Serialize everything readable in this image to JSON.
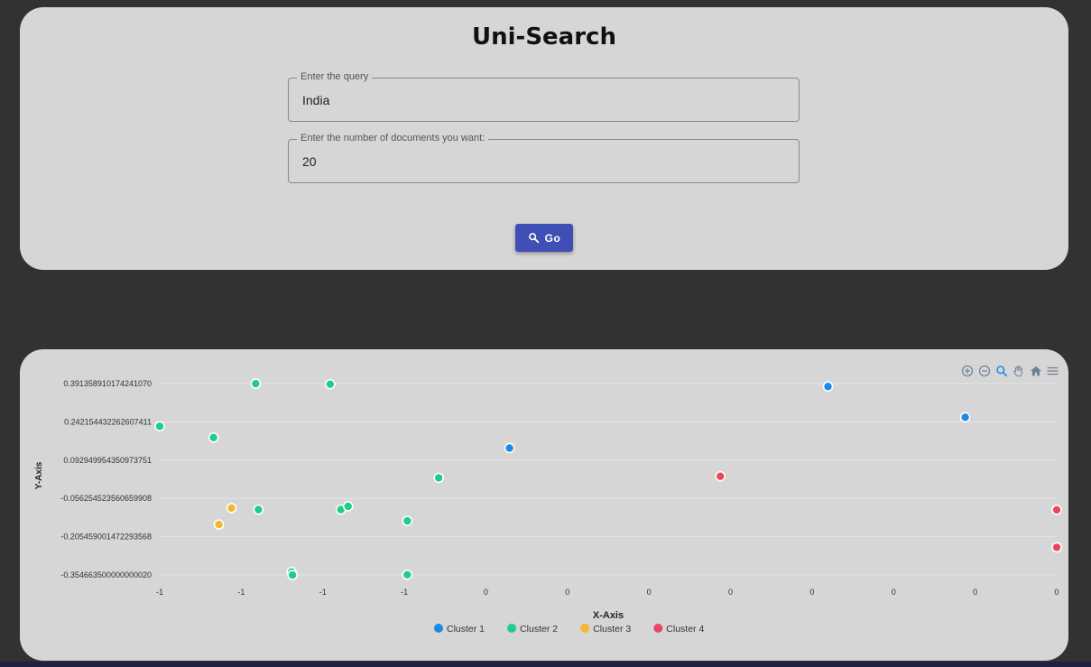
{
  "app": {
    "title": "Uni-Search"
  },
  "search": {
    "query_label": "Enter the query",
    "query_value": "India",
    "count_label": "Enter the number of documents you want:",
    "count_value": "20",
    "go_label": "Go",
    "go_icon": "search-icon"
  },
  "toolbar": {
    "icons": [
      "zoom-in-icon",
      "zoom-out-icon",
      "magnify-icon",
      "pan-hand-icon",
      "home-icon",
      "menu-icon"
    ],
    "active_color": "#1e88e5",
    "icon_color": "#6e8192"
  },
  "chart_data": {
    "type": "scatter",
    "xlabel": "X-Axis",
    "ylabel": "Y-Axis",
    "xlim": [
      0,
      1
    ],
    "ylim": [
      -0.3546635,
      0.39135891017424107
    ],
    "x_tick_labels": [
      "-1",
      "-1",
      "-1",
      "-1",
      "0",
      "0",
      "0",
      "0",
      "0",
      "0",
      "0",
      "0"
    ],
    "y_tick_labels": [
      "0.391358910174241070",
      "0.242154432262607411",
      "0.092949954350973751",
      "-0.056254523560659908",
      "-0.205459001472293568",
      "-0.354663500000000020"
    ],
    "legend_position": "bottom-center",
    "series": [
      {
        "name": "Cluster 1",
        "color": "#1e88e5",
        "points": [
          [
            0.39,
            0.14
          ],
          [
            0.745,
            0.38
          ],
          [
            0.898,
            0.26
          ]
        ]
      },
      {
        "name": "Cluster 2",
        "color": "#22cc88",
        "points": [
          [
            0.107,
            0.391
          ],
          [
            0.19,
            0.389
          ],
          [
            0.0,
            0.225
          ],
          [
            0.06,
            0.181
          ],
          [
            0.311,
            0.024
          ],
          [
            0.11,
            -0.1
          ],
          [
            0.202,
            -0.1
          ],
          [
            0.21,
            -0.087
          ],
          [
            0.276,
            -0.144
          ],
          [
            0.147,
            -0.343
          ],
          [
            0.148,
            -0.355
          ],
          [
            0.276,
            -0.354
          ]
        ]
      },
      {
        "name": "Cluster 3",
        "color": "#f5b731",
        "points": [
          [
            0.08,
            -0.094
          ],
          [
            0.066,
            -0.158
          ]
        ]
      },
      {
        "name": "Cluster 4",
        "color": "#e8475f",
        "points": [
          [
            0.625,
            0.03
          ],
          [
            1.0,
            -0.101
          ],
          [
            1.0,
            -0.247
          ]
        ]
      }
    ]
  }
}
